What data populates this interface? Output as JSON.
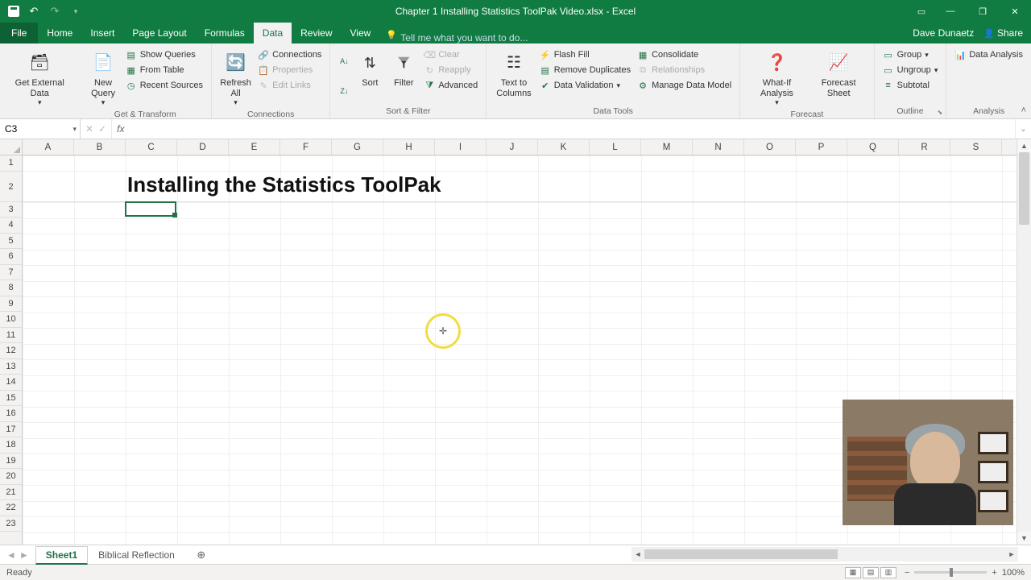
{
  "title_bar": {
    "document_title": "Chapter 1 Installing Statistics ToolPak Video.xlsx - Excel"
  },
  "tabs": {
    "file": "File",
    "items": [
      "Home",
      "Insert",
      "Page Layout",
      "Formulas",
      "Data",
      "Review",
      "View"
    ],
    "active_index": 4,
    "tell_me": "Tell me what you want to do...",
    "user_name": "Dave Dunaetz",
    "share": "Share"
  },
  "ribbon": {
    "get_transform": {
      "label": "Get & Transform",
      "external_data": "Get External Data",
      "new_query": "New Query",
      "show_queries": "Show Queries",
      "from_table": "From Table",
      "recent_sources": "Recent Sources"
    },
    "connections": {
      "label": "Connections",
      "refresh_all": "Refresh All",
      "connections": "Connections",
      "properties": "Properties",
      "edit_links": "Edit Links"
    },
    "sort_filter": {
      "label": "Sort & Filter",
      "sort": "Sort",
      "filter": "Filter",
      "clear": "Clear",
      "reapply": "Reapply",
      "advanced": "Advanced"
    },
    "data_tools": {
      "label": "Data Tools",
      "text_to_columns": "Text to Columns",
      "flash_fill": "Flash Fill",
      "remove_dup": "Remove Duplicates",
      "data_validation": "Data Validation",
      "consolidate": "Consolidate",
      "relationships": "Relationships",
      "manage_model": "Manage Data Model"
    },
    "forecast": {
      "label": "Forecast",
      "what_if": "What-If Analysis",
      "forecast_sheet": "Forecast Sheet"
    },
    "outline": {
      "label": "Outline",
      "group": "Group",
      "ungroup": "Ungroup",
      "subtotal": "Subtotal"
    },
    "analysis": {
      "label": "Analysis",
      "data_analysis": "Data Analysis"
    }
  },
  "formula_bar": {
    "name_box": "C3",
    "formula": ""
  },
  "grid": {
    "columns": [
      "A",
      "B",
      "C",
      "D",
      "E",
      "F",
      "G",
      "H",
      "I",
      "J",
      "K",
      "L",
      "M",
      "N",
      "O",
      "P",
      "Q",
      "R",
      "S"
    ],
    "rows": [
      1,
      2,
      3,
      4,
      5,
      6,
      7,
      8,
      9,
      10,
      11,
      12,
      13,
      14,
      15,
      16,
      17,
      18,
      19,
      20,
      21,
      22,
      23
    ],
    "heading_cell_value": "Installing the Statistics ToolPak",
    "selected_cell": "C3"
  },
  "sheet_tabs": {
    "tabs": [
      "Sheet1",
      "Biblical Reflection"
    ],
    "active_index": 0
  },
  "status_bar": {
    "status": "Ready",
    "zoom": "100%"
  }
}
